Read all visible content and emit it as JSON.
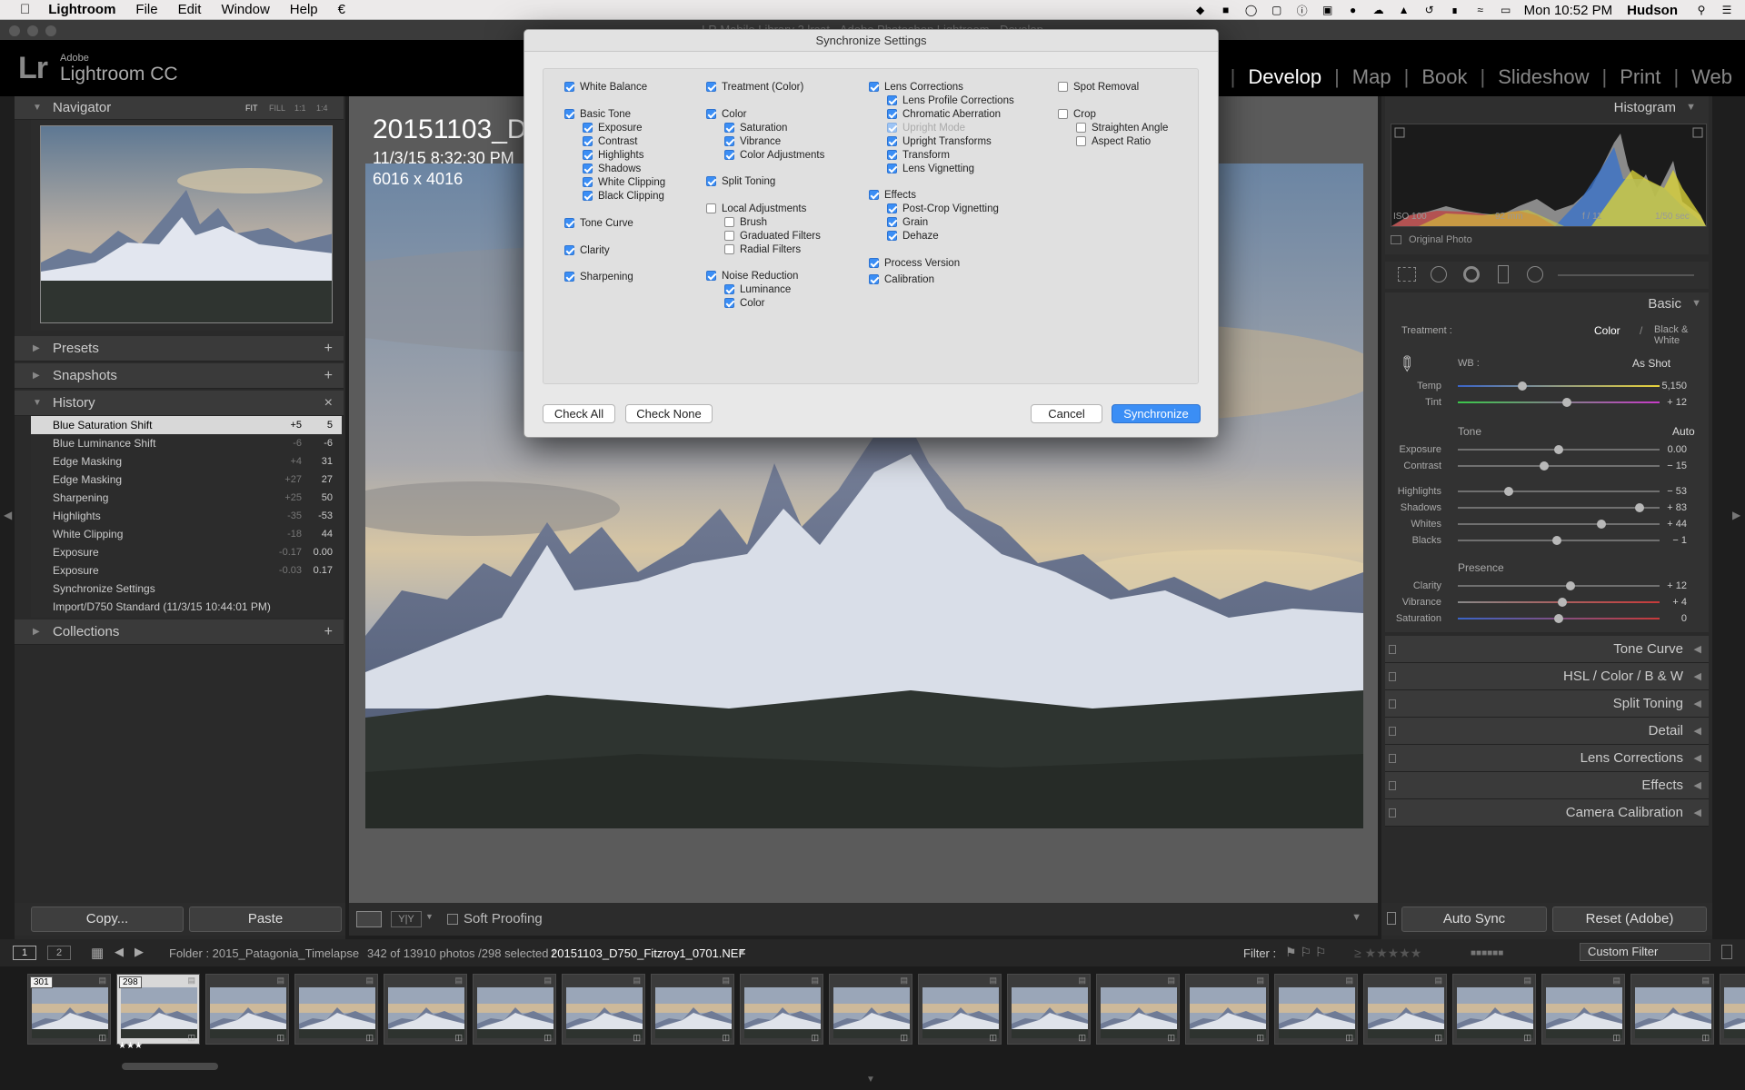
{
  "menubar": {
    "app": "Lightroom",
    "items": [
      "File",
      "Edit",
      "Window",
      "Help"
    ],
    "clock": "Mon 10:52 PM",
    "user": "Hudson"
  },
  "window_title": "LR Mobile Library 2.lrcat - Adobe Photoshop Lightroom - Develop",
  "brand": {
    "adobe": "Adobe",
    "product": "Lightroom CC",
    "logo": "Lr"
  },
  "modules": [
    "ary",
    "Develop",
    "Map",
    "Book",
    "Slideshow",
    "Print",
    "Web"
  ],
  "navigator": {
    "title": "Navigator",
    "zoom": [
      "FIT",
      "FILL",
      "1:1",
      "1:4"
    ]
  },
  "left_sections": {
    "presets": "Presets",
    "snapshots": "Snapshots",
    "history": "History",
    "collections": "Collections"
  },
  "history": [
    {
      "label": "Blue Saturation Shift",
      "delta": "+5",
      "value": "5"
    },
    {
      "label": "Blue Luminance Shift",
      "delta": "-6",
      "value": "-6"
    },
    {
      "label": "Edge Masking",
      "delta": "+4",
      "value": "31"
    },
    {
      "label": "Edge Masking",
      "delta": "+27",
      "value": "27"
    },
    {
      "label": "Sharpening",
      "delta": "+25",
      "value": "50"
    },
    {
      "label": "Highlights",
      "delta": "-35",
      "value": "-53"
    },
    {
      "label": "White Clipping",
      "delta": "-18",
      "value": "44"
    },
    {
      "label": "Exposure",
      "delta": "-0.17",
      "value": "0.00"
    },
    {
      "label": "Exposure",
      "delta": "-0.03",
      "value": "0.17"
    },
    {
      "label": "Synchronize Settings",
      "delta": "",
      "value": ""
    },
    {
      "label": "Import/D750 Standard (11/3/15 10:44:01 PM)",
      "delta": "",
      "value": ""
    }
  ],
  "photo_overlay": {
    "title": "20151103_D7",
    "date": "11/3/15 8:32:30 PM",
    "size": "6016 x 4016"
  },
  "left_buttons": {
    "copy": "Copy...",
    "paste": "Paste"
  },
  "toolbar": {
    "soft_proofing": "Soft Proofing"
  },
  "histogram": {
    "title": "Histogram",
    "iso": "ISO 100",
    "focal": "92 mm",
    "aperture": "f / 11",
    "shutter": "1/50 sec",
    "original": "Original Photo"
  },
  "basic": {
    "title": "Basic",
    "treatment_label": "Treatment :",
    "treatment_color": "Color",
    "treatment_bw": "Black & White",
    "wb_label": "WB :",
    "wb_value": "As Shot",
    "tone_label": "Tone",
    "auto": "Auto",
    "presence_label": "Presence",
    "sliders": [
      {
        "label": "Temp",
        "value": "5,150",
        "pos": 0.32
      },
      {
        "label": "Tint",
        "value": "+ 12",
        "pos": 0.54
      },
      {
        "label": "Exposure",
        "value": "0.00",
        "pos": 0.5
      },
      {
        "label": "Contrast",
        "value": "− 15",
        "pos": 0.43
      },
      {
        "label": "Highlights",
        "value": "− 53",
        "pos": 0.25
      },
      {
        "label": "Shadows",
        "value": "+ 83",
        "pos": 0.9
      },
      {
        "label": "Whites",
        "value": "+ 44",
        "pos": 0.71
      },
      {
        "label": "Blacks",
        "value": "− 1",
        "pos": 0.49
      },
      {
        "label": "Clarity",
        "value": "+ 12",
        "pos": 0.56
      },
      {
        "label": "Vibrance",
        "value": "+ 4",
        "pos": 0.52
      },
      {
        "label": "Saturation",
        "value": "0",
        "pos": 0.5
      }
    ]
  },
  "right_sections": [
    "Tone Curve",
    "HSL / Color / B & W",
    "Split Toning",
    "Detail",
    "Lens Corrections",
    "Effects",
    "Camera Calibration"
  ],
  "right_buttons": {
    "auto_sync": "Auto Sync",
    "reset": "Reset (Adobe)"
  },
  "filmstrip": {
    "folder": "Folder : 2015_Patagonia_Timelapse",
    "count": "342 of 13910 photos /298 selected /",
    "file": "20151103_D750_Fitzroy1_0701.NEF",
    "filter_label": "Filter :",
    "filter_value": "Custom Filter",
    "badges": [
      "301",
      "298"
    ],
    "stars": "★★★"
  },
  "dialog": {
    "title": "Synchronize Settings",
    "check_all": "Check All",
    "check_none": "Check None",
    "cancel": "Cancel",
    "sync": "Synchronize",
    "col1": [
      {
        "label": "White Balance",
        "on": true,
        "indent": false
      },
      {
        "label": "Basic Tone",
        "on": true,
        "indent": false
      },
      {
        "label": "Exposure",
        "on": true,
        "indent": true
      },
      {
        "label": "Contrast",
        "on": true,
        "indent": true
      },
      {
        "label": "Highlights",
        "on": true,
        "indent": true
      },
      {
        "label": "Shadows",
        "on": true,
        "indent": true
      },
      {
        "label": "White Clipping",
        "on": true,
        "indent": true
      },
      {
        "label": "Black Clipping",
        "on": true,
        "indent": true
      },
      {
        "label": "Tone Curve",
        "on": true,
        "indent": false
      },
      {
        "label": "Clarity",
        "on": true,
        "indent": false
      },
      {
        "label": "Sharpening",
        "on": true,
        "indent": false
      }
    ],
    "col2": [
      {
        "label": "Treatment (Color)",
        "on": true,
        "indent": false
      },
      {
        "label": "Color",
        "on": true,
        "indent": false
      },
      {
        "label": "Saturation",
        "on": true,
        "indent": true
      },
      {
        "label": "Vibrance",
        "on": true,
        "indent": true
      },
      {
        "label": "Color Adjustments",
        "on": true,
        "indent": true
      },
      {
        "label": "Split Toning",
        "on": true,
        "indent": false
      },
      {
        "label": "Local Adjustments",
        "on": false,
        "indent": false
      },
      {
        "label": "Brush",
        "on": false,
        "indent": true
      },
      {
        "label": "Graduated Filters",
        "on": false,
        "indent": true
      },
      {
        "label": "Radial Filters",
        "on": false,
        "indent": true
      },
      {
        "label": "Noise Reduction",
        "on": true,
        "indent": false
      },
      {
        "label": "Luminance",
        "on": true,
        "indent": true
      },
      {
        "label": "Color",
        "on": true,
        "indent": true
      }
    ],
    "col3": [
      {
        "label": "Lens Corrections",
        "on": true,
        "indent": false
      },
      {
        "label": "Lens Profile Corrections",
        "on": true,
        "indent": true
      },
      {
        "label": "Chromatic Aberration",
        "on": true,
        "indent": true
      },
      {
        "label": "Upright Mode",
        "on": true,
        "indent": true,
        "disabled": true
      },
      {
        "label": "Upright Transforms",
        "on": true,
        "indent": true
      },
      {
        "label": "Transform",
        "on": true,
        "indent": true
      },
      {
        "label": "Lens Vignetting",
        "on": true,
        "indent": true
      },
      {
        "label": "Effects",
        "on": true,
        "indent": false
      },
      {
        "label": "Post-Crop Vignetting",
        "on": true,
        "indent": true
      },
      {
        "label": "Grain",
        "on": true,
        "indent": true
      },
      {
        "label": "Dehaze",
        "on": true,
        "indent": true
      },
      {
        "label": "Process Version",
        "on": true,
        "indent": false
      },
      {
        "label": "Calibration",
        "on": true,
        "indent": false
      }
    ],
    "col4": [
      {
        "label": "Spot Removal",
        "on": false,
        "indent": false
      },
      {
        "label": "Crop",
        "on": false,
        "indent": false
      },
      {
        "label": "Straighten Angle",
        "on": false,
        "indent": true
      },
      {
        "label": "Aspect Ratio",
        "on": false,
        "indent": true
      }
    ]
  }
}
